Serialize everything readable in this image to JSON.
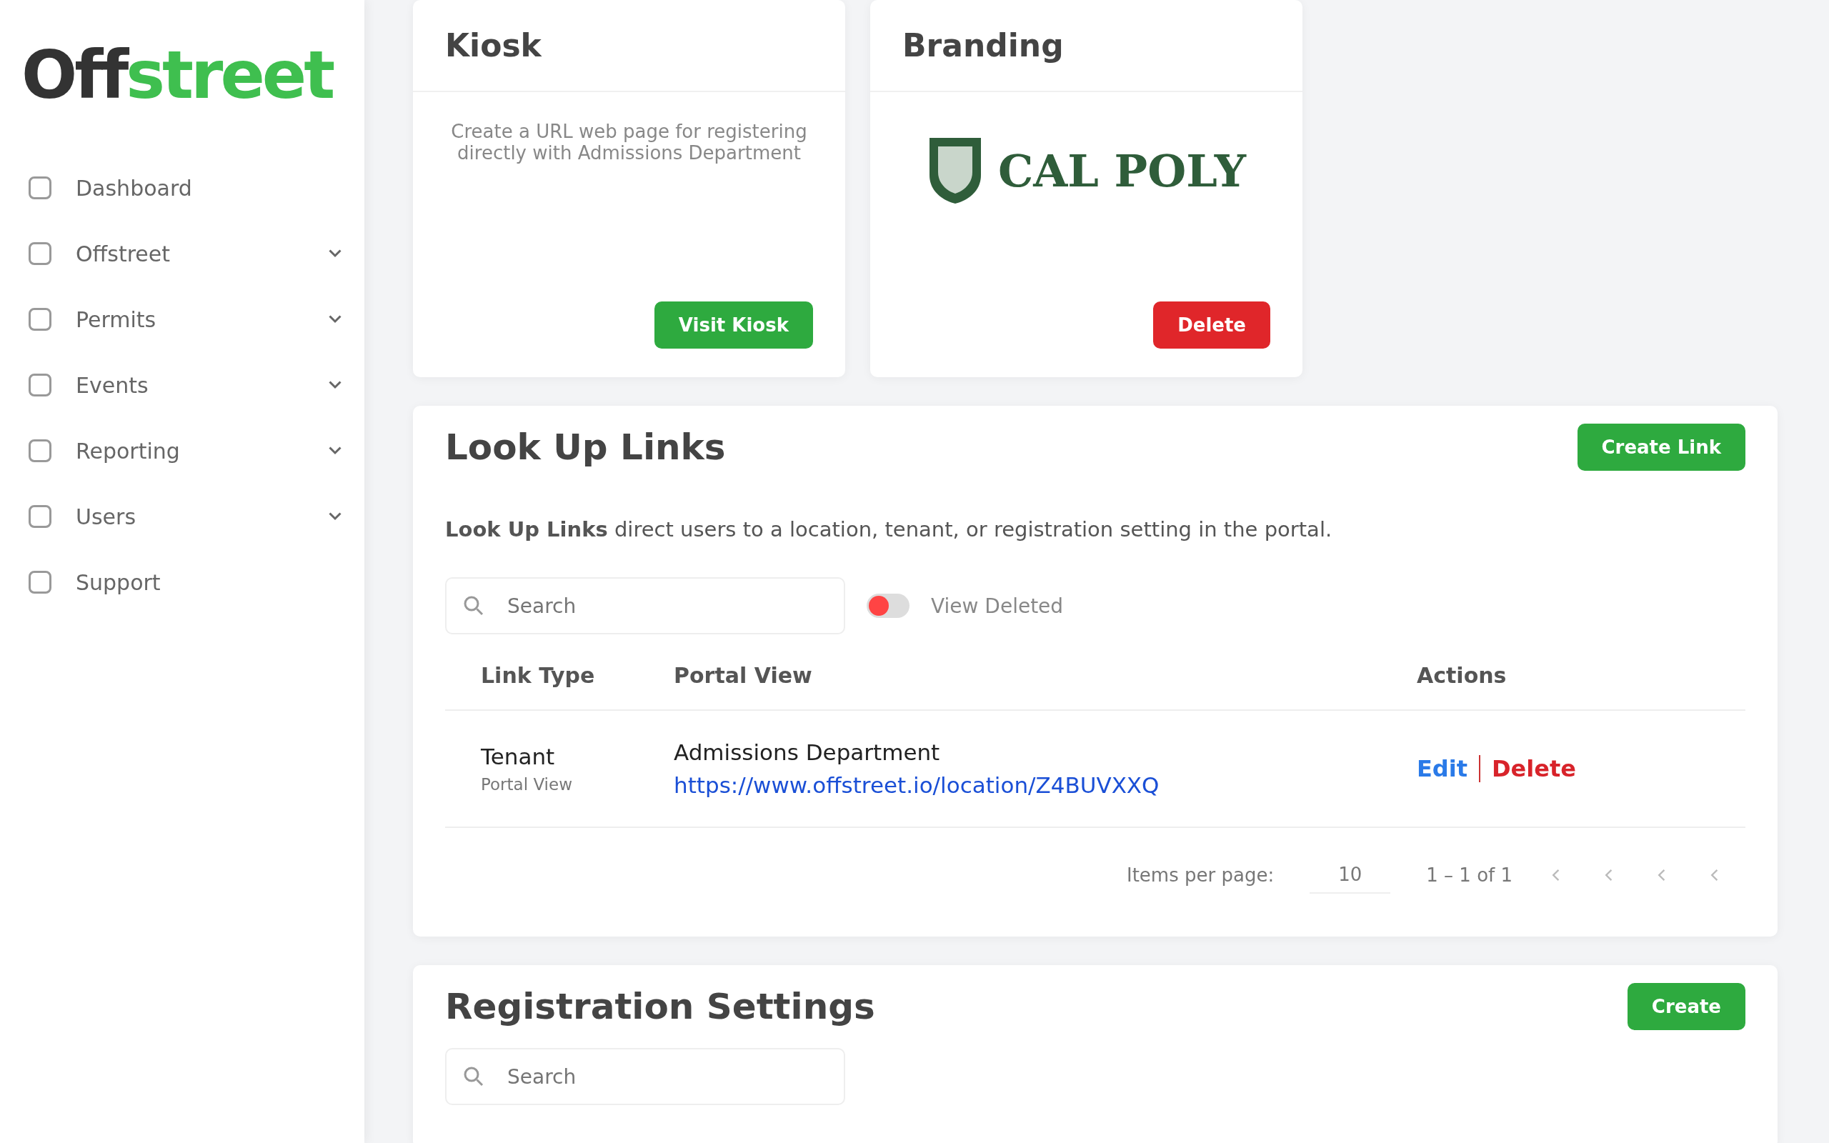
{
  "sidebar": {
    "logo": {
      "part_1": "Off",
      "part_2": "street"
    },
    "items": [
      {
        "label": "Dashboard",
        "has_submenu": false
      },
      {
        "label": "Offstreet",
        "has_submenu": true
      },
      {
        "label": "Permits",
        "has_submenu": true
      },
      {
        "label": "Events",
        "has_submenu": true
      },
      {
        "label": "Reporting",
        "has_submenu": true
      },
      {
        "label": "Users",
        "has_submenu": true
      },
      {
        "label": "Support",
        "has_submenu": false
      }
    ]
  },
  "kiosk": {
    "title": "Kiosk",
    "description": "Create a URL web page for registering directly with Admissions Department",
    "button": "Visit Kiosk"
  },
  "branding": {
    "title": "Branding",
    "logo_text": "CAL POLY",
    "button": "Delete"
  },
  "look_up_links": {
    "title": "Look Up Links",
    "button": "Create Link",
    "description": "**Look Up Links** direct users to a location, tenant, or registration setting in the portal.",
    "search": {
      "placeholder": "Search"
    },
    "view_deleted": {
      "label": "View Deleted",
      "on": false
    },
    "columns": [
      "Link Type",
      "Portal View",
      "Actions"
    ],
    "rows": [
      {
        "type": "Tenant",
        "subtype": "Portal View",
        "name": "Admissions Department",
        "url": "https://www.offstreet.io/location/Z4BUVXXQ",
        "actions": [
          "Edit",
          "Delete"
        ]
      }
    ],
    "pagination": {
      "label": "Items per page:",
      "per_page": "10",
      "range": "1 – 1 of 1"
    }
  },
  "registration_settings": {
    "title": "Registration Settings",
    "button": "Create",
    "search": {
      "placeholder": "Search"
    }
  }
}
